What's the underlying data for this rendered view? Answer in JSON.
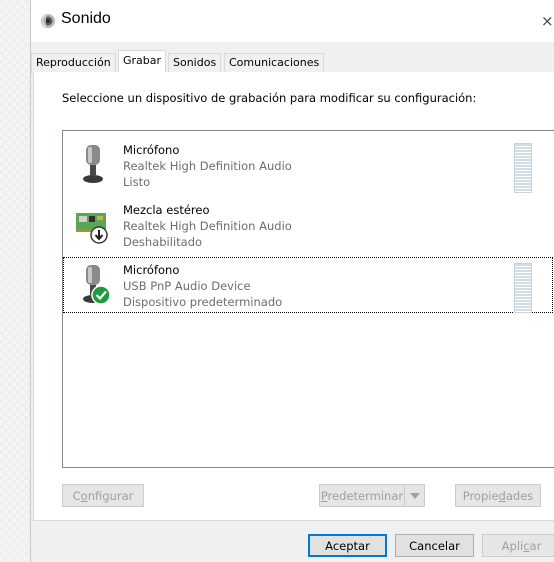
{
  "window": {
    "title": "Sonido",
    "close_glyph": "×"
  },
  "tabs": [
    {
      "label": "Reproducción",
      "active": false
    },
    {
      "label": "Grabar",
      "active": true
    },
    {
      "label": "Sonidos",
      "active": false
    },
    {
      "label": "Comunicaciones",
      "active": false
    }
  ],
  "panel": {
    "instruction": "Seleccione un dispositivo de grabación para modificar su configuración:"
  },
  "devices": [
    {
      "name": "Micrófono",
      "description": "Realtek High Definition Audio",
      "status": "Listo",
      "icon": "microphone-icon",
      "selected": false
    },
    {
      "name": "Mezcla estéreo",
      "description": "Realtek High Definition Audio",
      "status": "Deshabilitado",
      "icon": "sound-card-disabled-icon",
      "selected": false
    },
    {
      "name": "Micrófono",
      "description": "USB PnP Audio Device",
      "status": "Dispositivo predeterminado",
      "icon": "microphone-default-icon",
      "selected": true
    }
  ],
  "panel_buttons": {
    "configure": {
      "prefix": "C",
      "underlined": "o",
      "suffix": "nfigurar",
      "enabled": false
    },
    "set_default": {
      "prefix": "",
      "underlined": "P",
      "suffix": "redeterminar",
      "enabled": false
    },
    "properties": {
      "prefix": "Propie",
      "underlined": "d",
      "suffix": "ades",
      "enabled": false
    }
  },
  "footer_buttons": {
    "ok": "Aceptar",
    "cancel": "Cancelar",
    "apply": {
      "prefix": "Apli",
      "underlined": "c",
      "suffix": "ar",
      "enabled": false
    }
  },
  "colors": {
    "accent_focus": "#0078d7",
    "success_badge": "#1e9b3c",
    "disabled_text": "#a0a0a0"
  }
}
